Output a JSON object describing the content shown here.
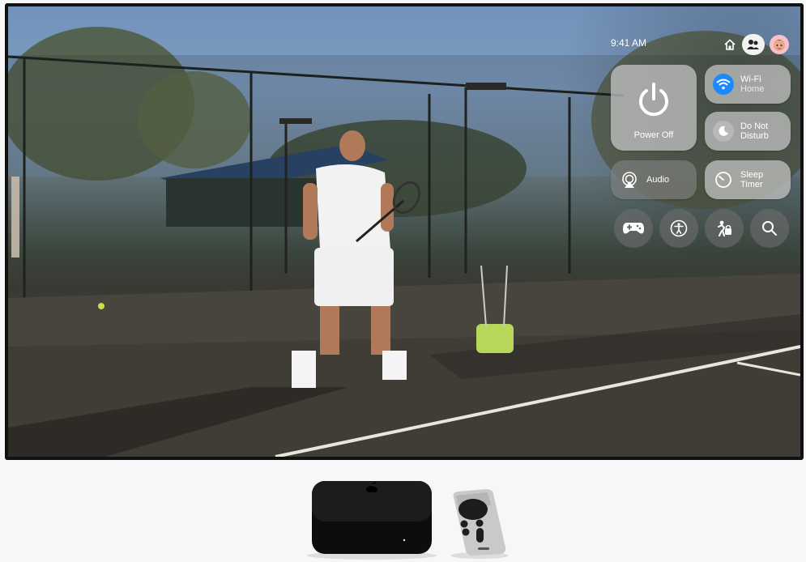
{
  "status_bar": {
    "time": "9:41 AM",
    "icons": [
      "home-icon",
      "user-switch-icon",
      "avatar"
    ]
  },
  "control_center": {
    "power": {
      "label": "Power Off",
      "icon": "power-icon"
    },
    "wifi": {
      "label": "Wi-Fi",
      "sublabel": "Home",
      "icon": "wifi-icon"
    },
    "dnd": {
      "label_line1": "Do Not",
      "label_line2": "Disturb",
      "icon": "moon-icon"
    },
    "audio": {
      "label": "Audio",
      "icon": "airplay-audio-icon"
    },
    "sleep_timer": {
      "label_line1": "Sleep",
      "label_line2": "Timer",
      "icon": "timer-icon"
    },
    "shortcuts": [
      "game-controller-icon",
      "accessibility-icon",
      "child-lock-icon",
      "search-icon"
    ]
  },
  "colors": {
    "wifi_accent": "#1e88ff",
    "tile_bg": "#828282",
    "avatar_bg": "#f6c1c8"
  }
}
